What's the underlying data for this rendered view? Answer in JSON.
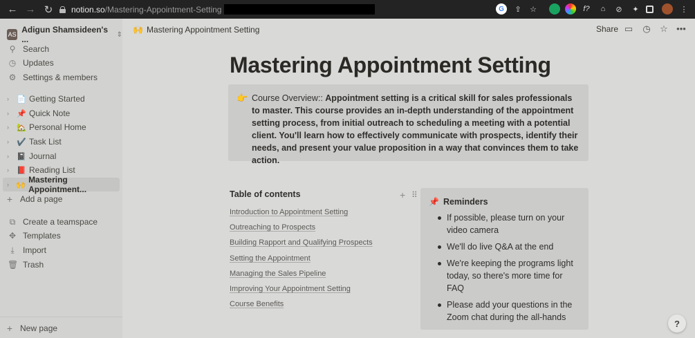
{
  "browser": {
    "url_host": "notion.so",
    "url_path": "/Mastering-Appointment-Setting"
  },
  "sidebar": {
    "workspace_name": "Adigun Shamsideen's ...",
    "workspace_avatar": "AS",
    "utilities": [
      {
        "label": "Search",
        "icon": "search-icon"
      },
      {
        "label": "Updates",
        "icon": "clock-icon"
      },
      {
        "label": "Settings & members",
        "icon": "gear-icon"
      }
    ],
    "pages": [
      {
        "label": "Getting Started",
        "emoji": "📄"
      },
      {
        "label": "Quick Note",
        "emoji": "📌"
      },
      {
        "label": "Personal Home",
        "emoji": "🏡"
      },
      {
        "label": "Task List",
        "emoji": "✔️"
      },
      {
        "label": "Journal",
        "emoji": "📓"
      },
      {
        "label": "Reading List",
        "emoji": "📕"
      },
      {
        "label": "Mastering Appointment...",
        "emoji": "🙌"
      }
    ],
    "add_page": "Add a page",
    "bottom": [
      {
        "label": "Create a teamspace",
        "icon": "teamspace-icon"
      },
      {
        "label": "Templates",
        "icon": "templates-icon"
      },
      {
        "label": "Import",
        "icon": "import-icon"
      },
      {
        "label": "Trash",
        "icon": "trash-icon"
      }
    ],
    "new_page": "New page"
  },
  "topbar": {
    "title": "Mastering Appointment Setting",
    "title_emoji": "🙌",
    "share": "Share"
  },
  "page": {
    "title": "Mastering Appointment Setting",
    "callout": {
      "icon": "👉",
      "lead": "Course Overview:: ",
      "body": "Appointment setting is a critical skill for sales professionals to master. This course provides an in-depth understanding of the appointment setting process, from initial outreach to scheduling a meeting with a potential client. You'll learn how to effectively communicate with prospects, identify their needs, and present your value proposition in a way that convinces them to take action."
    },
    "toc": {
      "title": "Table of contents",
      "items": [
        "Introduction to Appointment Setting",
        "Outreaching to Prospects",
        "Building Rapport and Qualifying Prospects",
        "Setting the Appointment",
        "Managing the Sales Pipeline",
        "Improving Your Appointment Setting",
        "Course Benefits"
      ]
    },
    "reminders": {
      "icon": "📌",
      "title": "Reminders",
      "items": [
        "If possible, please turn on your video camera",
        "We'll do live Q&A at the end",
        "We're keeping the programs light today, so there's more time for FAQ",
        "Please add your questions in the Zoom chat during the all-hands"
      ]
    }
  },
  "help_label": "?"
}
